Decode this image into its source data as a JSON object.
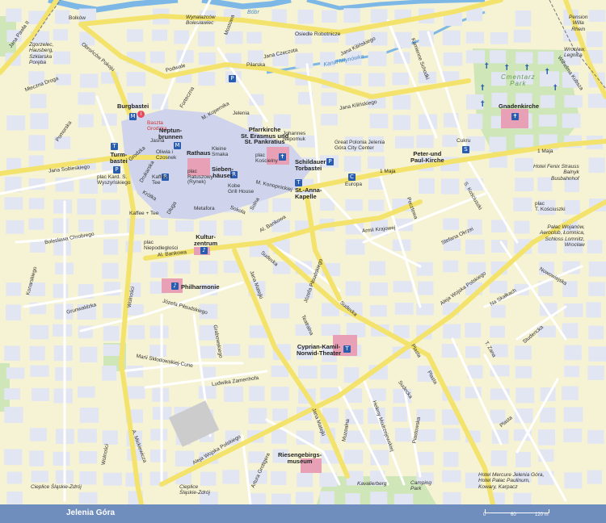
{
  "footer": {
    "title": "Jelenia Góra",
    "scale": [
      "0",
      "60",
      "120 m"
    ]
  },
  "colors": {
    "major_road": "#f3e36c",
    "minor_road": "#ffffff",
    "block": "#e2e6f2",
    "old_town": "#cfd4ec",
    "park": "#cfe6b9",
    "water": "#7db7e6",
    "footer": "#6f8dbd",
    "poi": "#e8a0b6"
  },
  "pois": {
    "burgbastei": "Burgbastei",
    "baszta": "Baszta\nGrodzka",
    "neptunbrunnen": "Neptun-\nbrunnen",
    "rathaus": "Rathaus",
    "siebenhauser": "Sieben-\nhäuser",
    "turmbastei": "Turm-\nbastei",
    "pfarrkirche": "Pfarrkirche\nSt. Erasmus und\nSt. Pankratius",
    "plac_koscielny": "plac\nKościelny",
    "johannes": "Johannes\nNepomuk",
    "schildauer": "Schildauer\nTorbastei",
    "st_anna": "St.-Anna-\nKapelle",
    "great_polonia": "Great Polonia Jelenia\nGóra City Center",
    "europa": "Europa",
    "peter_paul": "Peter-und\nPaul-Kirche",
    "cukru": "Cukru",
    "gnadenkirche": "Gnadenkirche",
    "cmentarz": "Cmentarz\nPark",
    "fenix": "Hotel Fenix Strauss\nBalnyk\nBusbahnhof",
    "plac_kosciuszki": "plac\nT. Kościuszki",
    "palac": "Pałac Wojanów,\nAeroclub, Łomnica,\nSchloss Lomnitz,\nWrocław",
    "kulturzentrum": "Kultur-\nzentrum",
    "philharmonie": "Philharmonie",
    "theater": "Cyprian-Kamil-\nNorwid-Theater",
    "riesengebirgs": "Riesengebirgs-\nmuseum",
    "mercure": "Hotel Mercure Jelenia Góra,\nHotel Pałac Paulinum,\nKowary, Karpacz",
    "oliwia": "Oliwia i\nCzosnek",
    "kleine_smaka": "Kleine\nSmaka",
    "plac_ratuszowy": "plac\nRatuszowy\n(Rynek)",
    "kaffee_tee": "Kaffee\nTee",
    "kobe": "Kobe\nGrill House",
    "metafora": "Metafora",
    "kaffee_tee2": "Kaffee + Tee",
    "plac_niepodl": "plac\nNiepodległości",
    "plac_wyszynski": "plac Kard. S.\nWyszyńskiego",
    "zgorzelec": "Zgorzelec,\nHausberg,\nSzklarska\nPoręba",
    "wynalazcow": "Wynalazców\nBolesławiec",
    "pension": "Pension\nWilla\nRhein",
    "wroclaw_legnica": "Wrocław,\nLegnica",
    "bobr": "Bóbr",
    "kanal": "Kanał Młynówka",
    "cieplice": "Cieplice Śląskie-Zdrój",
    "cieplice2": "Cieplice\nŚląskie-Zdrój",
    "kavalierberg": "Kavalierberg",
    "camping": "Camping\nPark"
  },
  "streets": {
    "jana_pawla": "Jana Pawła II",
    "bolkow": "Bolków",
    "osiedle": "Osiedle Robotnicze",
    "mostowa": "Mostowa",
    "podwale": "Podwale",
    "obroncow": "Obrońców Pokoju",
    "mieczna": "Mieczna Droga",
    "pilarska": "Pilarska",
    "jana_czeczota": "Jana Czeczota",
    "jana_kilinskiego": "Jana Kilińskiego",
    "kamienne": "Kamienne Schodki",
    "kilinskiego2": "Jana Kilińskiego",
    "wiejska": "Wilhelma Kubsza",
    "fortecna": "Forteczna",
    "kopernika": "M. Kopernika",
    "jeleni": "Jelenia",
    "pomorska": "Pomorska",
    "jana_sobieskiego": "Jana Sobieskiego",
    "grodzka": "Grodzka",
    "jasna": "Jasna",
    "kroka": "Krótka",
    "druciana": "Drukarska",
    "dluga": "Długa",
    "sokola": "Sokola",
    "solna": "Solna",
    "konopnickiej": "M. Konopnickiej",
    "bankowa": "Al. Bankowa",
    "bankowa2": "Al. Bankowa",
    "armii": "Armii Krajowej",
    "pocztowa": "Pocztowa",
    "wolnosci": "1 Maja",
    "maja": "1 Maja",
    "kosciuszki": "S. Kościuszki",
    "stefana": "Stefana Okrzei",
    "boleslawa": "Bolesława Chrobrego",
    "konarskiego": "Konarskiego",
    "grunwaldzka": "Grunwaldzka",
    "wolnosci2": "Wolności",
    "kardecka": "Kardynała",
    "sudecka": "Sudecka",
    "sudecka2": "Sudecka",
    "sudecka3": "Sudecka",
    "teatralna": "Teatralna",
    "jozefa": "Józefa Piłsudskiego",
    "jana_matejki": "Jana Matejki",
    "grabowskiego": "Grabowskiego",
    "ludwika": "Ludwika Zamenhofa",
    "marii": "Marii Skłodowskiej-Curie",
    "aleja_wojska": "Aleja Wojska Polskiego",
    "aleja_wojska2": "Aleja Wojska Polskiego",
    "jana_matejki2": "Jana Matejki",
    "muzealna": "Muzealna",
    "heleny": "Heleny Modrzejewskiej",
    "piastowska": "Piastowska",
    "plasta": "Plasta",
    "plasta2": "Plasta",
    "mickiewicza": "A. Mickiewicza",
    "wolnosci3": "Wolności",
    "artura": "Artura Grottgera",
    "nowowiejska": "Nowowiejska",
    "na_skalkach": "Na Skałkach",
    "studencka": "Studencka",
    "t_zana": "T. Zana",
    "plasta3": "Plasta",
    "jozefa_pilsudskiego": "Józefa Piłsudskiego"
  }
}
